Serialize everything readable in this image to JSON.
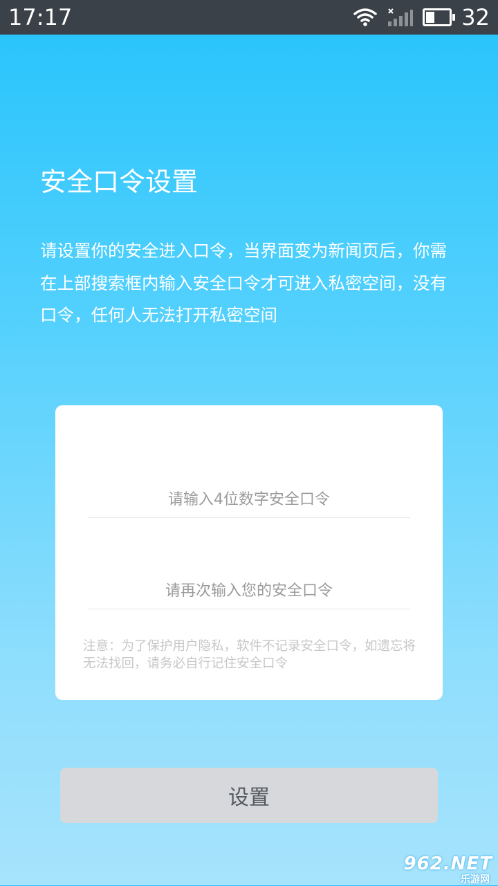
{
  "status_bar": {
    "time": "17:17",
    "battery": "32",
    "icons": [
      "wifi-icon",
      "signal-icon",
      "battery-icon"
    ]
  },
  "page": {
    "title": "安全口令设置",
    "description": "请设置你的安全进入口令，当界面变为新闻页后，你需在上部搜索框内输入安全口令才可进入私密空间，没有口令，任何人无法打开私密空间"
  },
  "form": {
    "password_placeholder": "请输入4位数字安全口令",
    "password_value": "",
    "confirm_placeholder": "请再次输入您的安全口令",
    "confirm_value": "",
    "note": "注意：为了保护用户隐私，软件不记录安全口令，如遗忘将无法找回，请务必自行记住安全口令"
  },
  "button": {
    "label": "设置"
  },
  "watermark": {
    "big": "962.NET",
    "small": "乐游网"
  },
  "colors": {
    "background_top": "#25c3fb",
    "background_bottom": "#a7e3fc",
    "status_bar": "#3b4148",
    "button_bg": "#d7d8db",
    "button_text": "#555a60"
  }
}
